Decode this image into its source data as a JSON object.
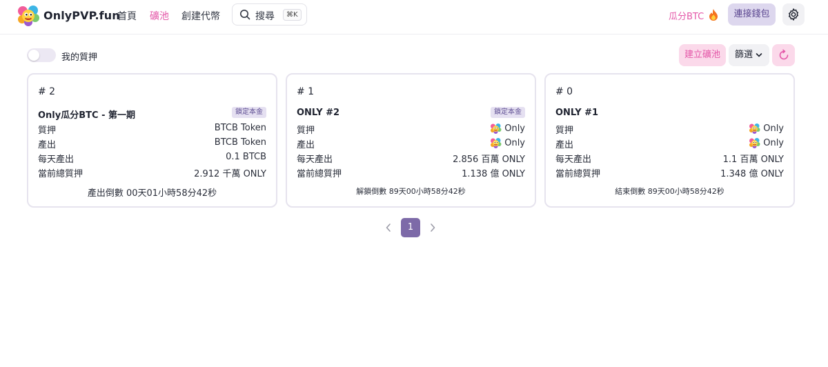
{
  "header": {
    "brand": "OnlyPVP.fun",
    "nav": [
      {
        "label": "首頁",
        "active": false
      },
      {
        "label": "礦池",
        "active": true
      },
      {
        "label": "創建代幣",
        "active": false
      }
    ],
    "search": {
      "label": "搜尋",
      "shortcut": "⌘K",
      "icon": "search-icon"
    },
    "promo": {
      "label": "瓜分BTC",
      "icon": "fire-icon"
    },
    "connect_label": "連接錢包",
    "settings_icon": "gear-icon",
    "accent_color": "#e457a8",
    "brand_purple": "#7d6aa8"
  },
  "toolbar": {
    "my_stake_label": "我的質押",
    "my_stake_on": false,
    "create_pool_label": "建立礦池",
    "filter_label": "篩選",
    "refresh_icon": "refresh-icon"
  },
  "cards": [
    {
      "id": "# 2",
      "name": "Only瓜分BTC - 第一期",
      "badge": "鎖定本金",
      "rows": [
        {
          "label": "質押",
          "value": "BTCB Token",
          "token_icon": false
        },
        {
          "label": "產出",
          "value": "BTCB Token",
          "token_icon": false
        },
        {
          "label": "每天產出",
          "value": "0.1 BTCB",
          "token_icon": false
        },
        {
          "label": "當前總質押",
          "value": "2.912 千萬 ONLY",
          "token_icon": false
        }
      ],
      "countdown": "產出倒數 00天01小時58分42秒"
    },
    {
      "id": "# 1",
      "name": "ONLY #2",
      "badge": "鎖定本金",
      "rows": [
        {
          "label": "質押",
          "value": "Only",
          "token_icon": true
        },
        {
          "label": "產出",
          "value": "Only",
          "token_icon": true
        },
        {
          "label": "每天產出",
          "value": "2.856 百萬 ONLY",
          "token_icon": false
        },
        {
          "label": "當前總質押",
          "value": "1.138 億 ONLY",
          "token_icon": false
        }
      ],
      "countdown": "解鎖倒數 89天00小時58分42秒"
    },
    {
      "id": "# 0",
      "name": "ONLY #1",
      "badge": "",
      "rows": [
        {
          "label": "質押",
          "value": "Only",
          "token_icon": true
        },
        {
          "label": "產出",
          "value": "Only",
          "token_icon": true
        },
        {
          "label": "每天產出",
          "value": "1.1 百萬 ONLY",
          "token_icon": false
        },
        {
          "label": "當前總質押",
          "value": "1.348 億 ONLY",
          "token_icon": false
        }
      ],
      "countdown": "結束倒數 89天00小時58分42秒"
    }
  ],
  "pagination": {
    "current": "1"
  }
}
